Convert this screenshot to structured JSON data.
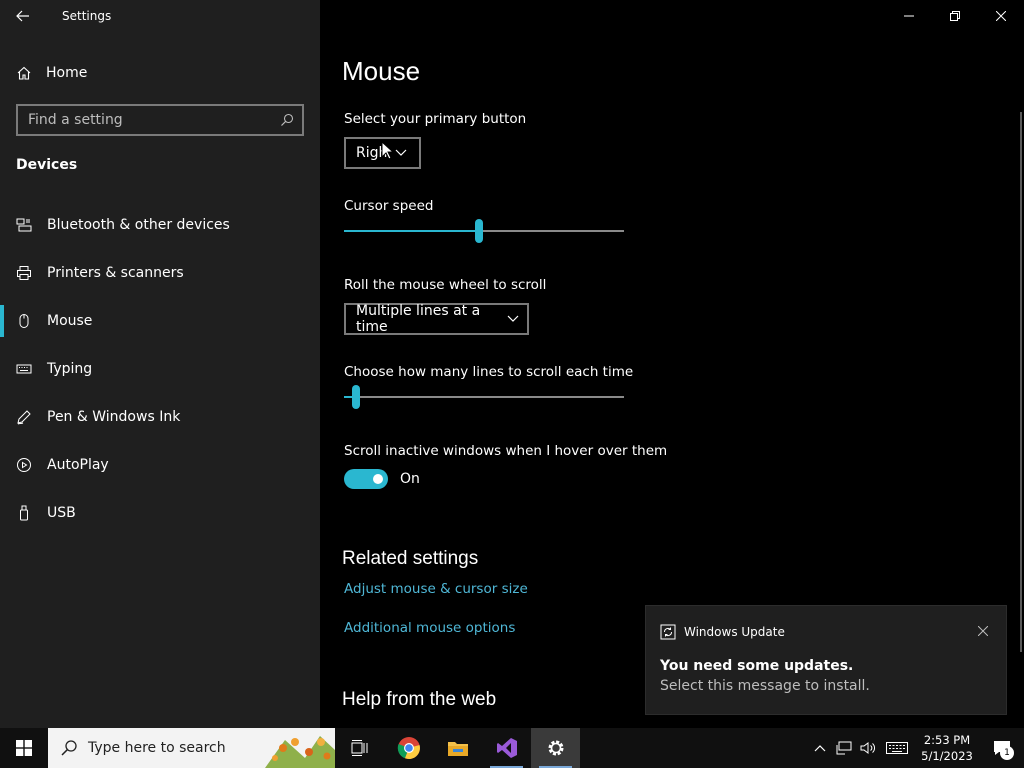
{
  "window": {
    "title": "Settings"
  },
  "sidebar": {
    "home_label": "Home",
    "search_placeholder": "Find a setting",
    "section_title": "Devices",
    "items": [
      {
        "label": "Bluetooth & other devices",
        "icon": "bluetooth-devices-icon"
      },
      {
        "label": "Printers & scanners",
        "icon": "printer-icon"
      },
      {
        "label": "Mouse",
        "icon": "mouse-icon",
        "active": true
      },
      {
        "label": "Typing",
        "icon": "keyboard-icon"
      },
      {
        "label": "Pen & Windows Ink",
        "icon": "pen-icon"
      },
      {
        "label": "AutoPlay",
        "icon": "autoplay-icon"
      },
      {
        "label": "USB",
        "icon": "usb-icon"
      }
    ]
  },
  "main": {
    "title": "Mouse",
    "primary_button_label": "Select your primary button",
    "primary_button_value": "Righ",
    "cursor_speed_label": "Cursor speed",
    "cursor_speed_value": 0.48,
    "scroll_label": "Roll the mouse wheel to scroll",
    "scroll_value": "Multiple lines at a time",
    "lines_label": "Choose how many lines to scroll each time",
    "lines_value": 0.03,
    "inactive_label": "Scroll inactive windows when I hover over them",
    "inactive_state": "On",
    "related_title": "Related settings",
    "link_cursor_size": "Adjust mouse & cursor size",
    "link_additional": "Additional mouse options",
    "help_title": "Help from the web"
  },
  "toast": {
    "app": "Windows Update",
    "title": "You need some updates.",
    "body": "Select this message to install."
  },
  "taskbar": {
    "search_placeholder": "Type here to search",
    "time": "2:53 PM",
    "date": "5/1/2023",
    "notification_count": "1"
  },
  "colors": {
    "accent": "#2ab7d0",
    "link": "#4fb7d6",
    "sidebar_bg": "#1f1f1f",
    "main_bg": "#000000"
  }
}
